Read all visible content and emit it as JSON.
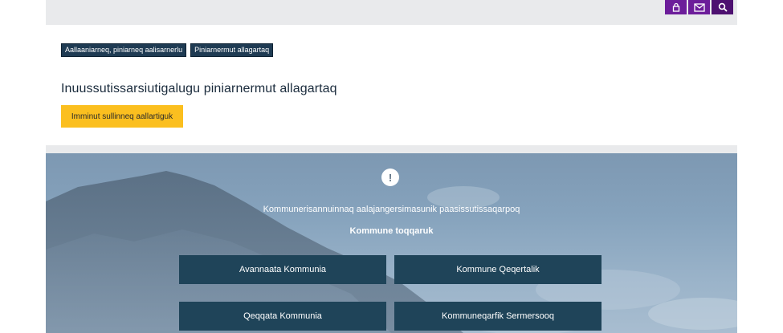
{
  "header": {
    "icons": [
      {
        "name": "lock-icon"
      },
      {
        "name": "mail-icon"
      },
      {
        "name": "search-icon"
      }
    ],
    "accent_color": "#6c1d9a"
  },
  "breadcrumb": {
    "items": [
      {
        "label": "Aallaaniarneq, piniarneq aalisarnerlu"
      },
      {
        "label": "Piniarnermut allagartaq"
      }
    ]
  },
  "main": {
    "title": "Inuussutissarsiutigalugu piniarnermut allagartaq",
    "cta_label": "Imminut sullinneq aallartiguk",
    "cta_color": "#fbbf1f"
  },
  "hero": {
    "alert_glyph": "!",
    "message": "Kommunerisannuinnaq aalajangersimasunik paasissutissaqarpoq",
    "subtitle": "Kommune toqqaruk",
    "municipalities": [
      {
        "label": "Avannaata Kommunia"
      },
      {
        "label": "Kommune Qeqertalik"
      },
      {
        "label": "Qeqqata Kommunia"
      },
      {
        "label": "Kommuneqarfik Sermersooq"
      }
    ],
    "button_color": "#1f4459"
  }
}
